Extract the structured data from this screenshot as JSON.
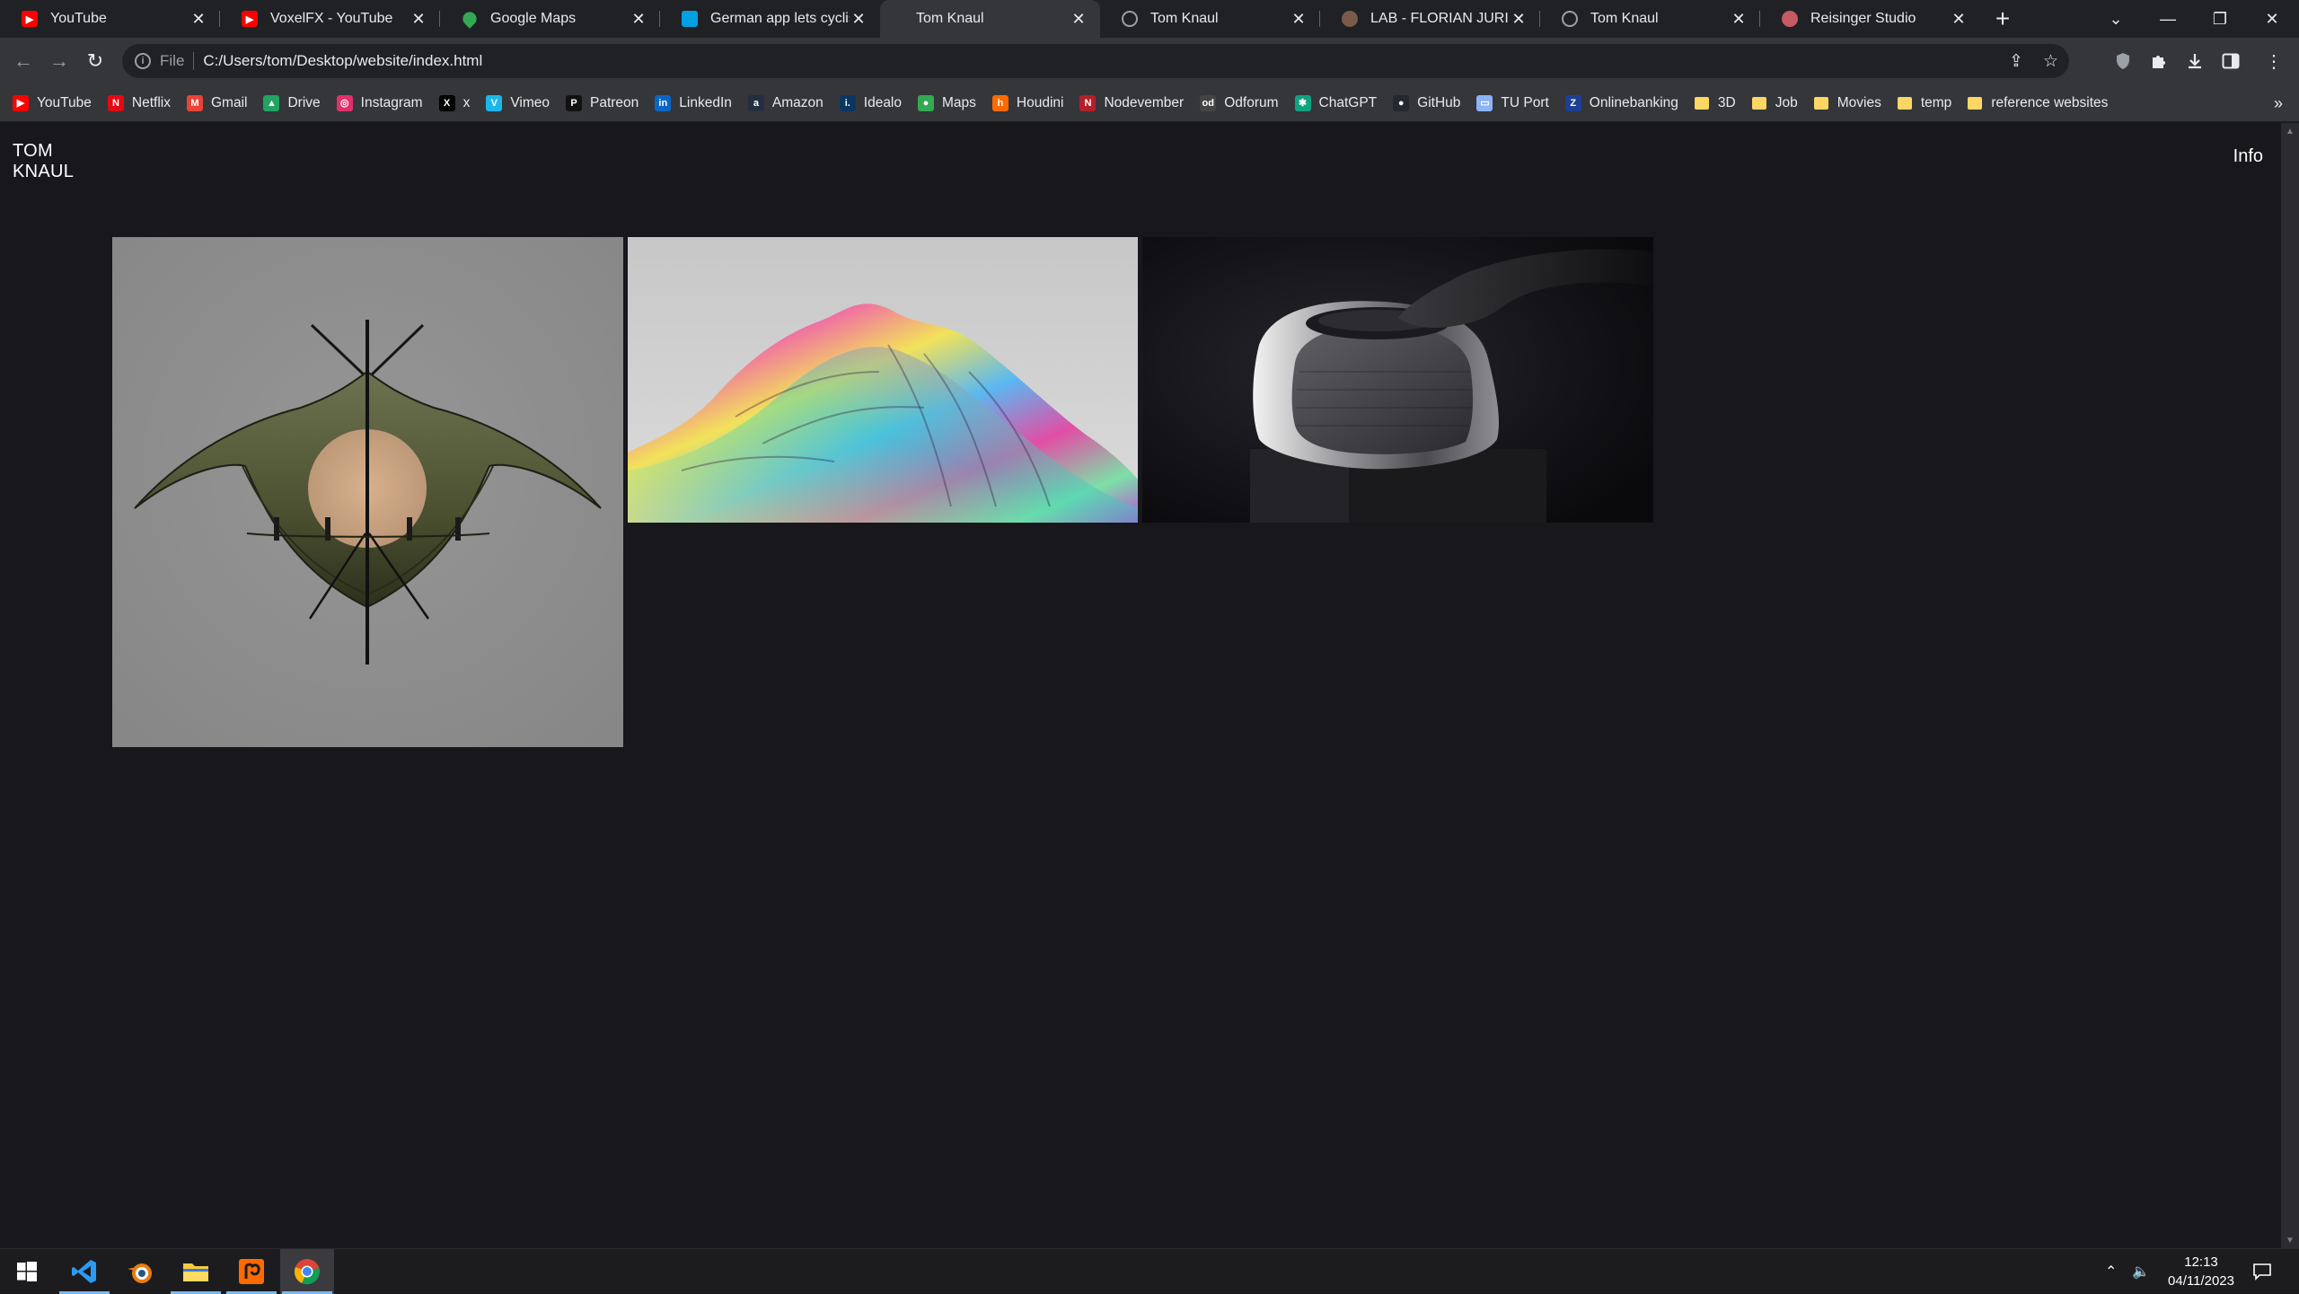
{
  "tabs": [
    {
      "title": "YouTube",
      "icon": "youtube-icon",
      "color": "#ff0000"
    },
    {
      "title": "VoxelFX - YouTube",
      "icon": "youtube-icon",
      "color": "#ff0000"
    },
    {
      "title": "Google Maps",
      "icon": "maps-pin-icon",
      "color": "#34a853"
    },
    {
      "title": "German app lets cyclists",
      "icon": "news-icon",
      "color": "#00a0e3"
    },
    {
      "title": "Tom Knaul",
      "icon": "",
      "color": ""
    },
    {
      "title": "Tom Knaul",
      "icon": "globe-icon",
      "color": "#9aa0a6"
    },
    {
      "title": "LAB - FLORIAN JURI",
      "icon": "site-icon",
      "color": "#7a5a4a"
    },
    {
      "title": "Tom Knaul",
      "icon": "globe-icon",
      "color": "#9aa0a6"
    },
    {
      "title": "Reisinger Studio",
      "icon": "site-icon",
      "color": "#c45a64"
    }
  ],
  "address": {
    "scheme": "File",
    "url": "C:/Users/tom/Desktop/website/index.html"
  },
  "bookmarks": [
    {
      "label": "YouTube",
      "icon": "youtube-icon",
      "color": "#ff0000",
      "glyph": "▶"
    },
    {
      "label": "Netflix",
      "icon": "netflix-icon",
      "color": "#e50914",
      "glyph": "N"
    },
    {
      "label": "Gmail",
      "icon": "gmail-icon",
      "color": "#ea4335",
      "glyph": "M"
    },
    {
      "label": "Drive",
      "icon": "drive-icon",
      "color": "#1fa463",
      "glyph": "▲"
    },
    {
      "label": "Instagram",
      "icon": "instagram-icon",
      "color": "#e1306c",
      "glyph": "◎"
    },
    {
      "label": "x",
      "icon": "x-icon",
      "color": "#000000",
      "glyph": "X"
    },
    {
      "label": "Vimeo",
      "icon": "vimeo-icon",
      "color": "#1ab7ea",
      "glyph": "V"
    },
    {
      "label": "Patreon",
      "icon": "patreon-icon",
      "color": "#111111",
      "glyph": "P"
    },
    {
      "label": "LinkedIn",
      "icon": "linkedin-icon",
      "color": "#0a66c2",
      "glyph": "in"
    },
    {
      "label": "Amazon",
      "icon": "amazon-icon",
      "color": "#232f3e",
      "glyph": "a"
    },
    {
      "label": "Idealo",
      "icon": "idealo-icon",
      "color": "#0a3761",
      "glyph": "i."
    },
    {
      "label": "Maps",
      "icon": "maps-pin-icon",
      "color": "#34a853",
      "glyph": "●"
    },
    {
      "label": "Houdini",
      "icon": "houdini-icon",
      "color": "#ff6a00",
      "glyph": "h"
    },
    {
      "label": "Nodevember",
      "icon": "nodevember-icon",
      "color": "#b3202a",
      "glyph": "N"
    },
    {
      "label": "Odforum",
      "icon": "odforum-icon",
      "color": "#444444",
      "glyph": "od"
    },
    {
      "label": "ChatGPT",
      "icon": "chatgpt-icon",
      "color": "#10a37f",
      "glyph": "✱"
    },
    {
      "label": "GitHub",
      "icon": "github-icon",
      "color": "#24292f",
      "glyph": "●"
    },
    {
      "label": "TU Port",
      "icon": "tuport-icon",
      "color": "#8ab4f8",
      "glyph": "▭"
    },
    {
      "label": "Onlinebanking",
      "icon": "bank-icon",
      "color": "#1d3f94",
      "glyph": "Z"
    },
    {
      "label": "3D",
      "icon": "folder-icon",
      "color": "#fdd663",
      "glyph": ""
    },
    {
      "label": "Job",
      "icon": "folder-icon",
      "color": "#fdd663",
      "glyph": ""
    },
    {
      "label": "Movies",
      "icon": "folder-icon",
      "color": "#fdd663",
      "glyph": ""
    },
    {
      "label": "temp",
      "icon": "folder-icon",
      "color": "#fdd663",
      "glyph": ""
    },
    {
      "label": "reference websites",
      "icon": "folder-icon",
      "color": "#fdd663",
      "glyph": ""
    }
  ],
  "site": {
    "name_line1": "TOM",
    "name_line2": "KNAUL",
    "info_link": "Info"
  },
  "gallery": [
    {
      "name": "olive-hammock-tent-render",
      "background": "#8a8a8a"
    },
    {
      "name": "iridescent-terrain-render",
      "background": "#cfcfcf"
    },
    {
      "name": "speaker-product-render",
      "background": "#0c0c10"
    }
  ],
  "taskbar": {
    "apps": [
      "windows-start-icon",
      "vscode-icon",
      "blender-icon",
      "file-explorer-icon",
      "houdini-icon",
      "chrome-icon"
    ],
    "time": "12:13",
    "date": "04/11/2023"
  }
}
